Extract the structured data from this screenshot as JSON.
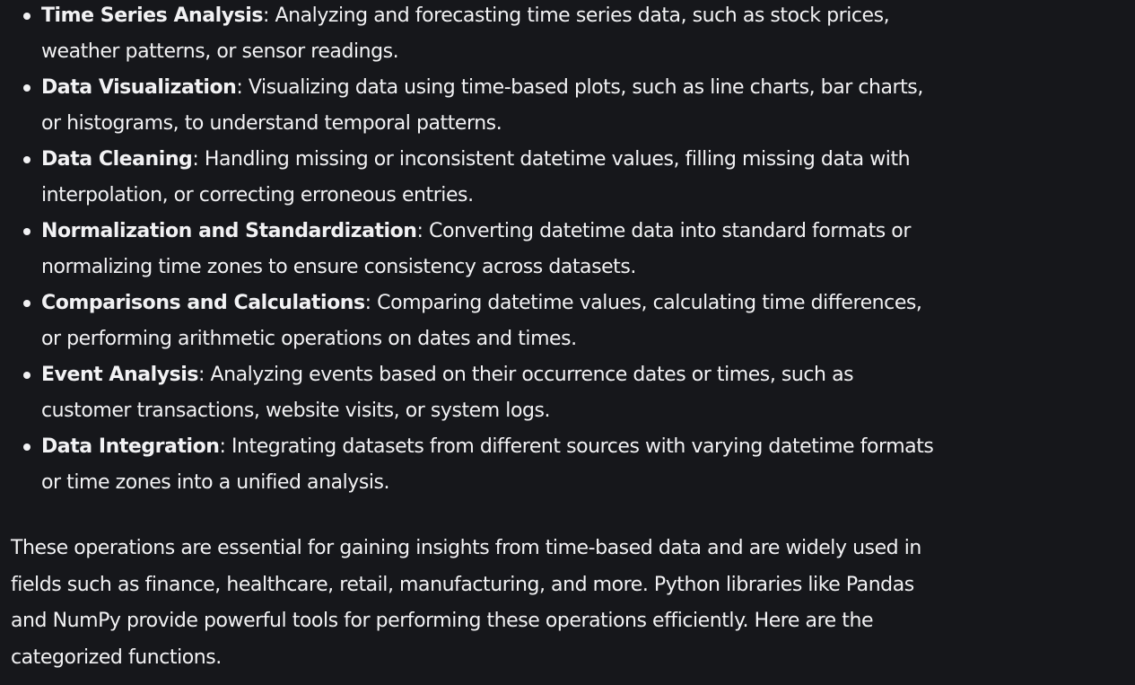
{
  "items": [
    {
      "term": "Time Series Analysis",
      "desc": ": Analyzing and forecasting time series data, such as stock prices, weather patterns, or sensor readings."
    },
    {
      "term": "Data Visualization",
      "desc": ": Visualizing data using time-based plots, such as line charts, bar charts, or histograms, to understand temporal patterns."
    },
    {
      "term": "Data Cleaning",
      "desc": ": Handling missing or inconsistent datetime values, filling missing data with interpolation, or correcting erroneous entries."
    },
    {
      "term": "Normalization and Standardization",
      "desc": ": Converting datetime data into standard formats or normalizing time zones to ensure consistency across datasets."
    },
    {
      "term": "Comparisons and Calculations",
      "desc": ": Comparing datetime values, calculating time differences, or performing arithmetic operations on dates and times."
    },
    {
      "term": "Event Analysis",
      "desc": ": Analyzing events based on their occurrence dates or times, such as customer transactions, website visits, or system logs."
    },
    {
      "term": "Data Integration",
      "desc": ": Integrating datasets from different sources with varying datetime formats or time zones into a unified analysis."
    }
  ],
  "paragraph": "These operations are essential for gaining insights from time-based data and are widely used in fields such as finance, healthcare, retail, manufacturing, and more. Python libraries like Pandas and NumPy provide powerful tools for performing these operations efficiently. Here are the categorized functions.",
  "colors": {
    "background": "#16171b",
    "text": "#f2f2f4"
  }
}
